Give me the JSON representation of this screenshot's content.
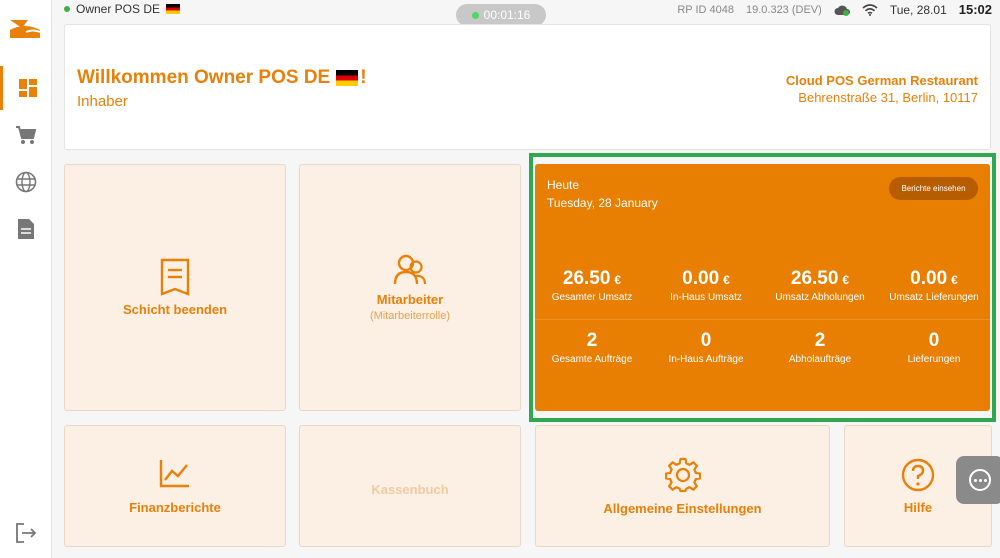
{
  "status": {
    "user": "Owner POS DE",
    "timer": "00:01:16",
    "rp_id": "RP ID 4048",
    "version": "19.0.323 (DEV)",
    "date": "Tue, 28.01",
    "time": "15:02"
  },
  "header": {
    "welcome": "Willkommen Owner POS DE",
    "exclamation": "!",
    "role": "Inhaber",
    "restaurant_name": "Cloud POS German Restaurant",
    "restaurant_address": "Behrenstraße 31, Berlin, 10117"
  },
  "tiles": {
    "shift_end": "Schicht beenden",
    "employees": "Mitarbeiter",
    "employees_sub": "(Mitarbeiterrolle)",
    "finance": "Finanzberichte",
    "cashbook": "Kassenbuch",
    "settings": "Allgemeine Einstellungen",
    "help": "Hilfe"
  },
  "stats": {
    "today": "Heute",
    "date": "Tuesday, 28 January",
    "report_button": "Berichte einsehen",
    "currency": "€",
    "revenue": [
      {
        "value": "26.50",
        "label": "Gesamter Umsatz"
      },
      {
        "value": "0.00",
        "label": "In-Haus Umsatz"
      },
      {
        "value": "26.50",
        "label": "Umsatz Abholungen"
      },
      {
        "value": "0.00",
        "label": "Umsatz Lieferungen"
      }
    ],
    "orders": [
      {
        "value": "2",
        "label": "Gesamte Aufträge"
      },
      {
        "value": "0",
        "label": "In-Haus Aufträge"
      },
      {
        "value": "2",
        "label": "Abholaufträge"
      },
      {
        "value": "0",
        "label": "Lieferungen"
      }
    ]
  },
  "colors": {
    "accent": "#e8800a",
    "stats_bg": "#e87e02",
    "highlight": "#2fa84f"
  }
}
